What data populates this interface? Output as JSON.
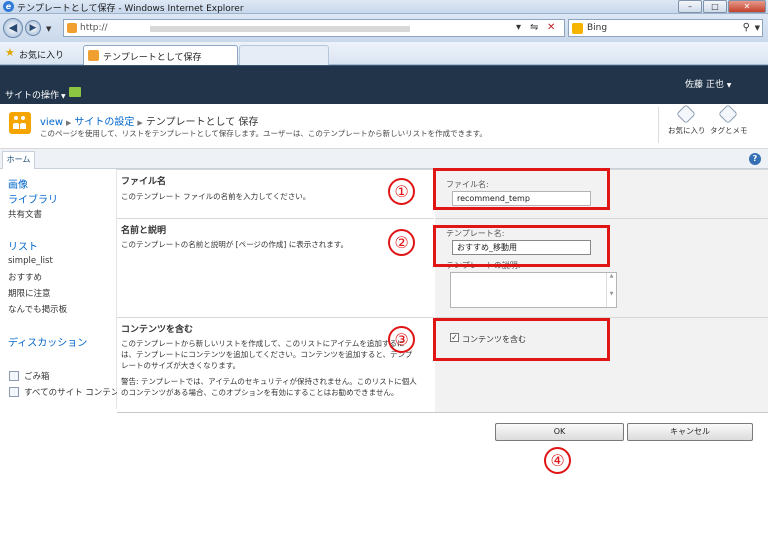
{
  "browser": {
    "window_title": "テンプレートとして保存 - Windows Internet Explorer",
    "url": "http://",
    "search_engine": "Bing",
    "favorites_label": "お気に入り",
    "tab_title": "テンプレートとして保存",
    "window_controls": [
      "–",
      "□",
      "✕"
    ]
  },
  "ribbon": {
    "site_actions": "サイトの操作",
    "user_name": "佐藤 正也"
  },
  "header": {
    "breadcrumb": [
      "view",
      "サイトの設定",
      "テンプレートとして 保存"
    ],
    "description": "このページを使用して、リストをテンプレートとして保存します。ユーザーは、このテンプレートから新しいリストを作成できます。",
    "favorite_label": "お気に入り",
    "tags_label": "タグとメモ",
    "home_tab": "ホーム",
    "help": "?"
  },
  "leftnav": {
    "items": [
      {
        "label": "画像",
        "kind": "head"
      },
      {
        "label": "ライブラリ",
        "kind": "head"
      },
      {
        "label": "共有文書",
        "kind": "sub"
      },
      {
        "label": "リスト",
        "kind": "head"
      },
      {
        "label": "simple_list",
        "kind": "sub"
      },
      {
        "label": "おすすめ",
        "kind": "sub"
      },
      {
        "label": "期限に注意",
        "kind": "sub"
      },
      {
        "label": "なんでも掲示板",
        "kind": "sub"
      },
      {
        "label": "ディスカッション",
        "kind": "head"
      }
    ],
    "recycle_bin": "ごみ箱",
    "all_content": "すべてのサイト コンテンツ"
  },
  "form": {
    "file_section": {
      "title": "ファイル名",
      "description": "このテンプレート ファイルの名前を入力してください。",
      "field_label": "ファイル名:",
      "value": "recommend_temp"
    },
    "name_section": {
      "title": "名前と説明",
      "description": "このテンプレートの名前と説明が [ページの作成] に表示されます。",
      "name_label": "テンプレート名:",
      "name_value": "おすすめ_移動用",
      "desc_label": "テンプレートの説明:"
    },
    "content_section": {
      "title": "コンテンツを含む",
      "description": "このテンプレートから新しいリストを作成して、このリストにアイテムを追加するには、テンプレートにコンテンツを追加してください。コンテンツを追加すると、テンプレートのサイズが大きくなります。",
      "warning": "警告: テンプレートでは、アイテムのセキュリティが保持されません。このリストに個人のコンテンツがある場合、このオプションを有効にすることはお勧めできません。",
      "checkbox_label": "コンテンツを含む",
      "checked": true
    },
    "ok_label": "OK",
    "cancel_label": "キャンセル"
  },
  "annotations": {
    "color": "#e01515",
    "numbers": [
      "①",
      "②",
      "③",
      "④"
    ]
  }
}
